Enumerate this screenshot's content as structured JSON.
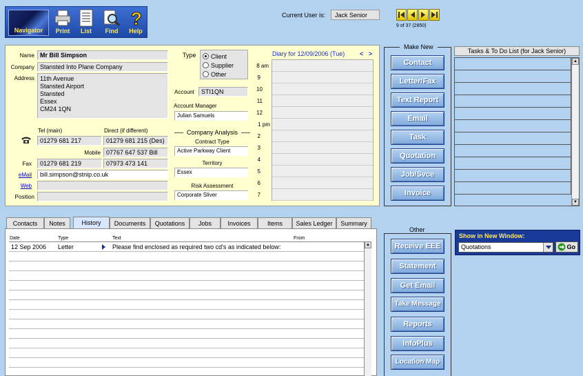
{
  "toolbar": {
    "navigator": "Navigator",
    "print": "Print",
    "list": "List",
    "find": "Find",
    "help": "Help"
  },
  "session": {
    "current_user_label": "Current User is:",
    "current_user": "Jack Senior",
    "record_count": "9 of 37 (2850)"
  },
  "contact": {
    "name_label": "Name",
    "name": "Mr Bill Simpson",
    "company_label": "Company",
    "company": "Stansted Into Plane Company",
    "address_label": "Address",
    "address_lines": [
      "11th Avenue",
      "Stansted Airport",
      "Stansted",
      "Essex",
      "CM24 1QN"
    ],
    "tel_main_label": "Tel (main)",
    "direct_label": "Direct (if different)",
    "tel_main": "01279 681 217",
    "direct": "01279 681 215 (Des)",
    "mobile_label": "Mobile",
    "mobile": "07767 647 537 Bill",
    "fax_label": "Fax",
    "fax": "01279 681 219",
    "fax2": "07973 473 141",
    "email_label": "eMail",
    "email": "bill.simpson@stnip.co.uk",
    "web_label": "Web",
    "web": "",
    "position_label": "Position",
    "position": ""
  },
  "type": {
    "label": "Type",
    "options": [
      "Client",
      "Supplier",
      "Other"
    ],
    "selected": "Client"
  },
  "account": {
    "label": "Account",
    "value": "STI1QN",
    "manager_label": "Account Manager",
    "manager": "Julian Samuels"
  },
  "analysis": {
    "header": "Company Analysis",
    "contract_type_label": "Contract Type",
    "contract_type": "Active Parkway Client",
    "territory_label": "Territory",
    "territory": "Essex",
    "risk_label": "Risk Assessment",
    "risk": "Corporate Sliver"
  },
  "diary": {
    "title": "Diary for 12/09/2006 (Tue)",
    "prev": "<",
    "next": ">",
    "hours": [
      "8 am",
      "9",
      "10",
      "11",
      "12",
      "1 pm",
      "2",
      "3",
      "4",
      "5",
      "6",
      "7"
    ]
  },
  "make_new": {
    "title": "Make New",
    "buttons": [
      "Contact",
      "Letter/Fax",
      "Text Report",
      "Email",
      "Task",
      "Quotation",
      "Job/Svce",
      "Invoice"
    ]
  },
  "tasks": {
    "title": "Tasks & To Do List (for Jack Senior)"
  },
  "tabs": [
    "Contacts",
    "Notes",
    "History",
    "Documents",
    "Quotations",
    "Jobs",
    "Invoices",
    "Items",
    "Sales Ledger",
    "Summary"
  ],
  "active_tab": "History",
  "history": {
    "columns": [
      "Date",
      "Type",
      "Text",
      "From"
    ],
    "rows": [
      {
        "date": "12 Sep 2006",
        "type": "Letter",
        "text": "Please find enclosed as required two cd's as indicated below:",
        "from": ""
      }
    ]
  },
  "other": {
    "title": "Other",
    "buttons": [
      "Receive EEE",
      "Statement",
      "Get Email",
      "Take Message",
      "Reports",
      "InfoPlus",
      "Location Map"
    ]
  },
  "new_window": {
    "title": "Show in New Window:",
    "selected": "Quotations",
    "go": "Go"
  }
}
